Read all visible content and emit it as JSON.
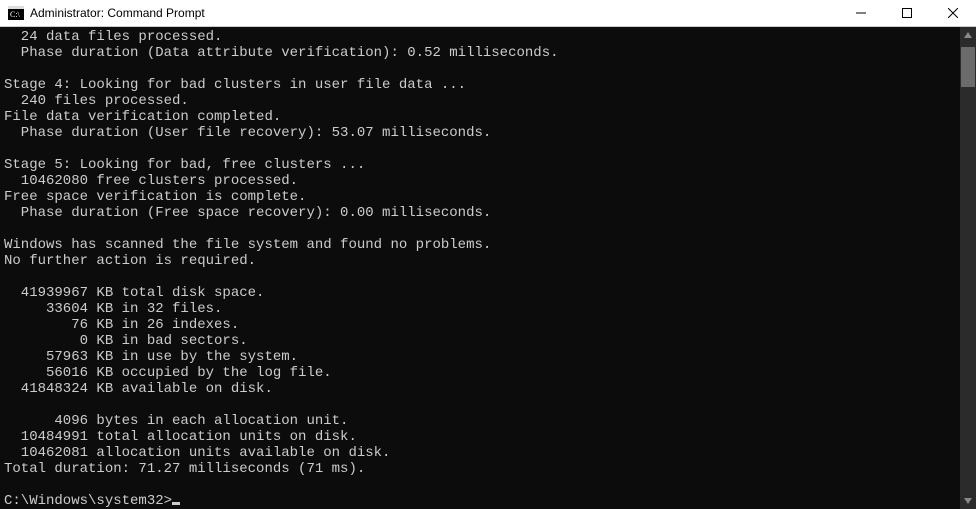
{
  "window": {
    "title": "Administrator: Command Prompt"
  },
  "output": {
    "l1": "  24 data files processed.",
    "l2": "  Phase duration (Data attribute verification): 0.52 milliseconds.",
    "l3": "",
    "l4": "Stage 4: Looking for bad clusters in user file data ...",
    "l5": "  240 files processed.",
    "l6": "File data verification completed.",
    "l7": "  Phase duration (User file recovery): 53.07 milliseconds.",
    "l8": "",
    "l9": "Stage 5: Looking for bad, free clusters ...",
    "l10": "  10462080 free clusters processed.",
    "l11": "Free space verification is complete.",
    "l12": "  Phase duration (Free space recovery): 0.00 milliseconds.",
    "l13": "",
    "l14": "Windows has scanned the file system and found no problems.",
    "l15": "No further action is required.",
    "l16": "",
    "l17": "  41939967 KB total disk space.",
    "l18": "     33604 KB in 32 files.",
    "l19": "        76 KB in 26 indexes.",
    "l20": "         0 KB in bad sectors.",
    "l21": "     57963 KB in use by the system.",
    "l22": "     56016 KB occupied by the log file.",
    "l23": "  41848324 KB available on disk.",
    "l24": "",
    "l25": "      4096 bytes in each allocation unit.",
    "l26": "  10484991 total allocation units on disk.",
    "l27": "  10462081 allocation units available on disk.",
    "l28": "Total duration: 71.27 milliseconds (71 ms).",
    "l29": ""
  },
  "prompt": "C:\\Windows\\system32>"
}
